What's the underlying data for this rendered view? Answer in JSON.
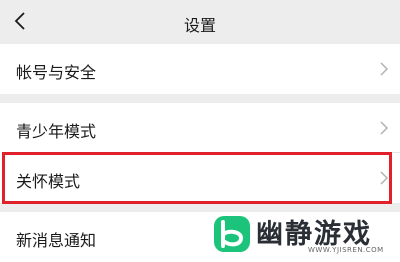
{
  "header": {
    "title": "设置",
    "back_icon": "chevron-left-icon"
  },
  "settings": {
    "account_security": "帐号与安全",
    "youth_mode": "青少年模式",
    "care_mode": "关怀模式",
    "new_message_notice": "新消息通知"
  },
  "highlight": {
    "target": "care_mode",
    "color": "#e0202a"
  },
  "watermark": {
    "brand": "幽静游戏",
    "url": "WWW.YJISREN.COM",
    "logo_color": "#1bc47a"
  }
}
